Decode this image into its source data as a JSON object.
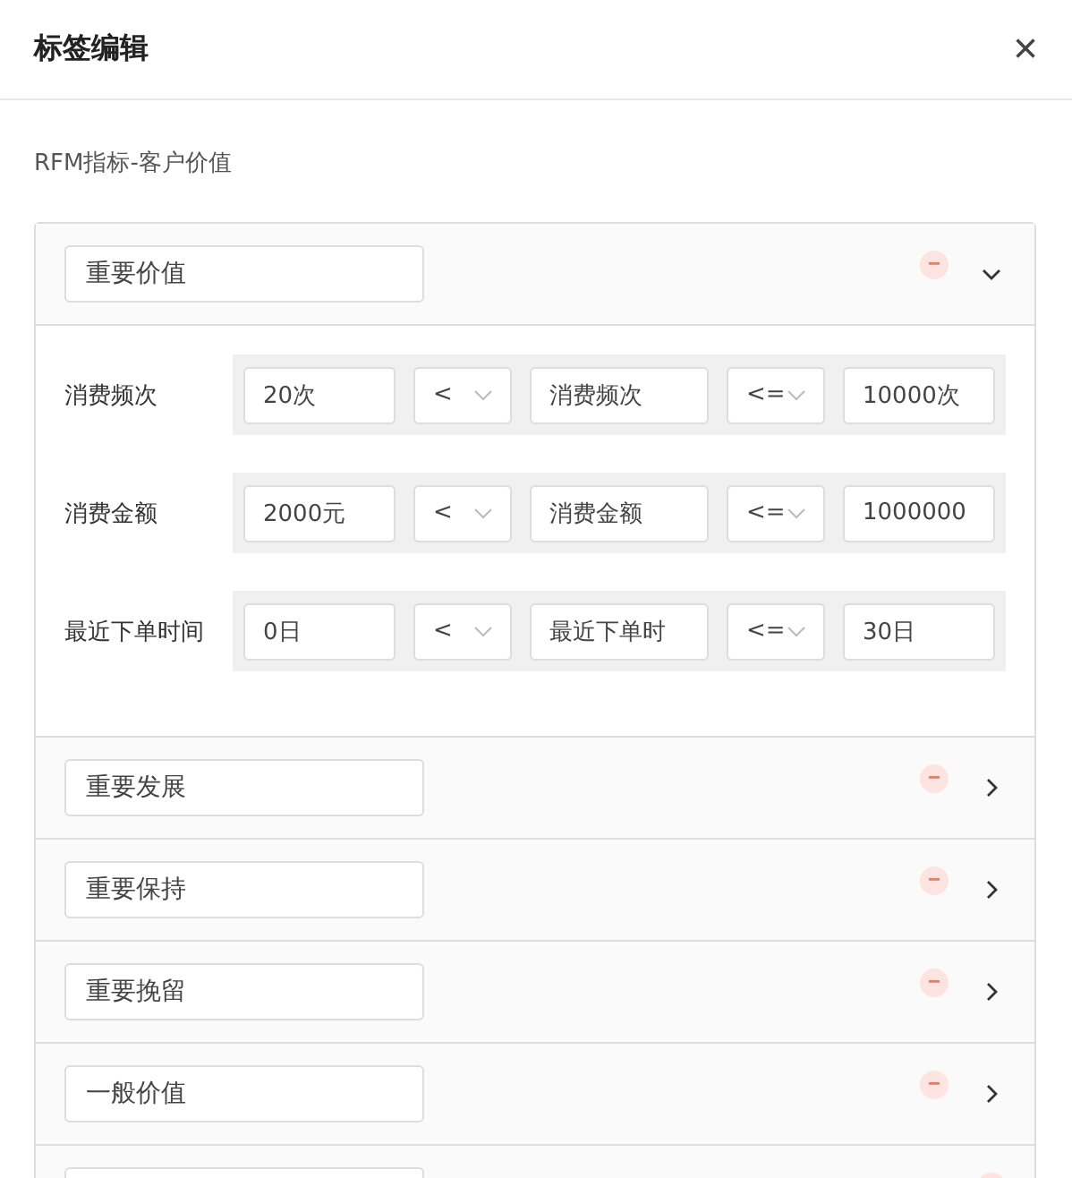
{
  "dialog": {
    "title": "标签编辑",
    "close": "×"
  },
  "subtitle": "RFM指标-客户价值",
  "groups": [
    {
      "name": "重要价值",
      "expanded": true,
      "rules": [
        {
          "label": "消费频次",
          "min": "20次",
          "op1": "<",
          "field": "消费频次",
          "op2": "<=",
          "max": "10000次"
        },
        {
          "label": "消费金额",
          "min": "2000元",
          "op1": "<",
          "field": "消费金额",
          "op2": "<=",
          "max": "1000000"
        },
        {
          "label": "最近下单时间",
          "min": "0日",
          "op1": "<",
          "field": "最近下单时",
          "op2": "<=",
          "max": "30日"
        }
      ]
    },
    {
      "name": "重要发展",
      "expanded": false
    },
    {
      "name": "重要保持",
      "expanded": false
    },
    {
      "name": "重要挽留",
      "expanded": false
    },
    {
      "name": "一般价值",
      "expanded": false
    },
    {
      "expanded": false
    }
  ]
}
